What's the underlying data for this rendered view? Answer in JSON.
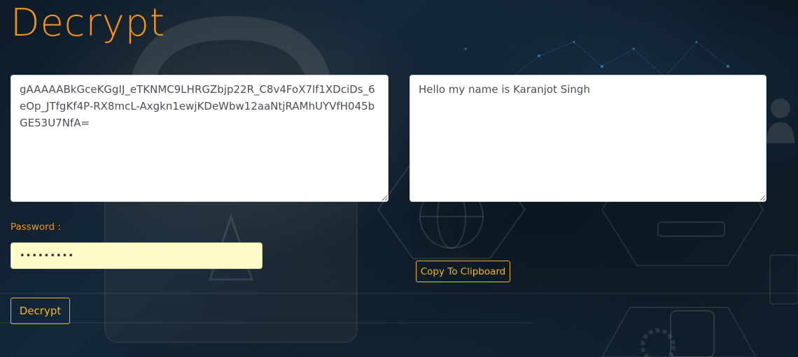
{
  "page": {
    "title": "Decrypt"
  },
  "ciphertext": {
    "value": "gAAAAABkGceKGgIJ_eTKNMC9LHRGZbjp22R_C8v4FoX7lf1XDciDs_6eOp_JTfgKf4P-RX8mcL-Axgkn1ewjKDeWbw12aaNtjRAMhUYVfH045bGE53U7NfA="
  },
  "plaintext": {
    "value": "Hello my name is Karanjot Singh"
  },
  "password": {
    "label": "Password :",
    "value": "•••••••••"
  },
  "buttons": {
    "copy_label": "Copy To Clipboard",
    "decrypt_label": "Decrypt"
  },
  "colors": {
    "accent": "#f5921e",
    "button_outline": "#f0b826",
    "password_bg": "#fffcc8"
  }
}
